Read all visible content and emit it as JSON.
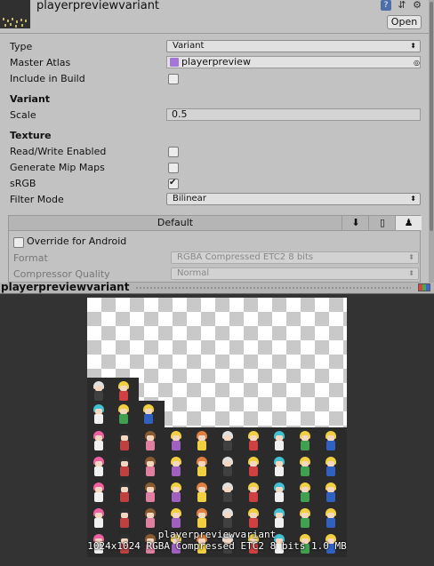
{
  "header": {
    "title": "playerpreviewvariant",
    "open_label": "Open",
    "icons": [
      "help-icon",
      "settings-sliders-icon",
      "gear-icon"
    ]
  },
  "fields": {
    "type": {
      "label": "Type",
      "value": "Variant"
    },
    "master_atlas": {
      "label": "Master Atlas",
      "value": "playerpreview"
    },
    "include_in_build": {
      "label": "Include in Build",
      "checked": false
    },
    "variant_heading": "Variant",
    "scale": {
      "label": "Scale",
      "value": "0.5"
    },
    "texture_heading": "Texture",
    "read_write": {
      "label": "Read/Write Enabled",
      "checked": false
    },
    "mip_maps": {
      "label": "Generate Mip Maps",
      "checked": false
    },
    "srgb": {
      "label": "sRGB",
      "checked": true
    },
    "filter_mode": {
      "label": "Filter Mode",
      "value": "Bilinear"
    }
  },
  "platform": {
    "default_tab": "Default",
    "tab_icons": [
      "download-icon",
      "phone-icon",
      "android-icon"
    ],
    "override_label": "Override for Android",
    "override_checked": false,
    "format": {
      "label": "Format",
      "value": "RGBA Compressed ETC2 8 bits"
    },
    "compressor_quality": {
      "label": "Compressor Quality",
      "value": "Normal"
    }
  },
  "preview": {
    "title": "playerpreviewvariant",
    "caption_line1": "playerpreviewvariant",
    "caption_line2": "1024x1024 RGBA Compressed ETC2 8 bits   1.0 MB"
  },
  "colors": {
    "panel_bg": "#c2c2c2",
    "preview_bg": "#333333",
    "atlas_icon": "#a675d8"
  }
}
